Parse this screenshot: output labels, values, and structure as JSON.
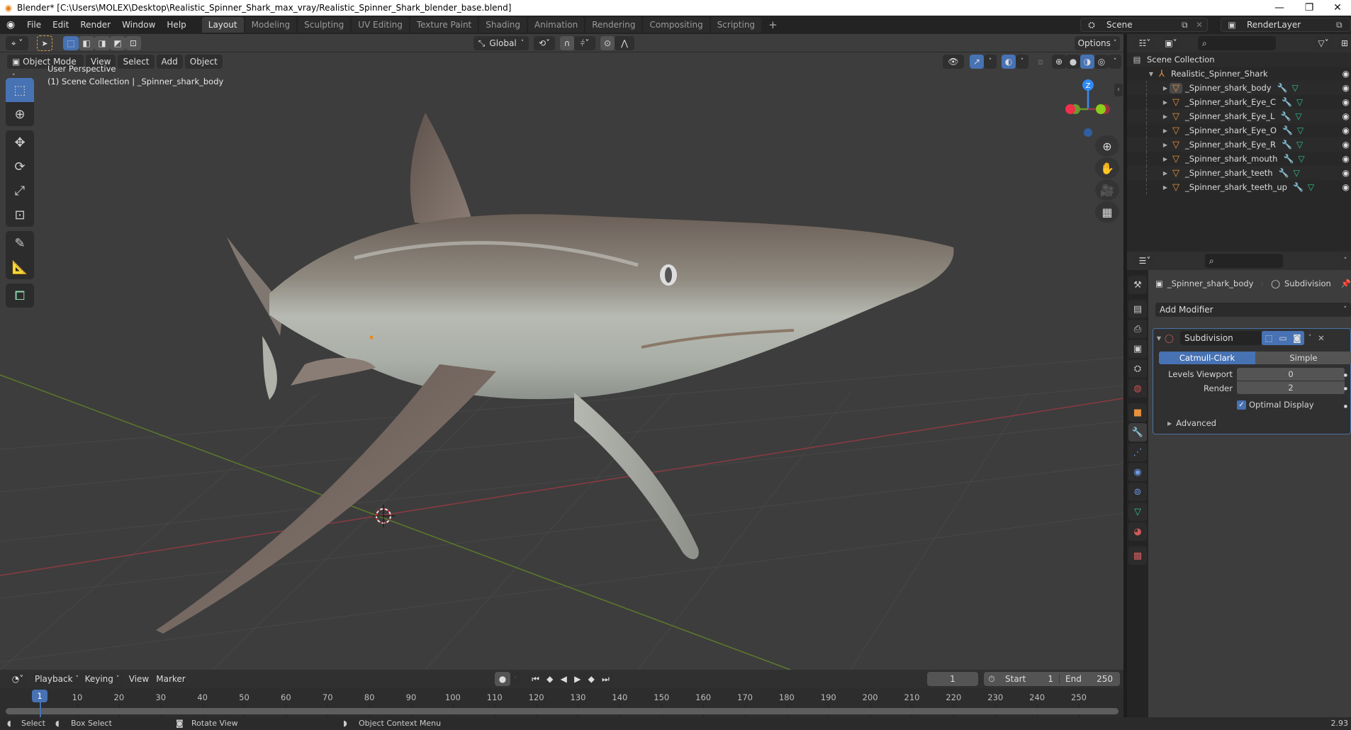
{
  "window": {
    "title": "Blender* [C:\\Users\\MOLEX\\Desktop\\Realistic_Spinner_Shark_max_vray/Realistic_Spinner_Shark_blender_base.blend]",
    "controls": {
      "minimize": "—",
      "restore": "❐",
      "close": "✕"
    }
  },
  "topbar": {
    "menus": [
      "File",
      "Edit",
      "Render",
      "Window",
      "Help"
    ],
    "workspaces": [
      "Layout",
      "Modeling",
      "Sculpting",
      "UV Editing",
      "Texture Paint",
      "Shading",
      "Animation",
      "Rendering",
      "Compositing",
      "Scripting"
    ],
    "active_workspace": "Layout",
    "add_workspace": "+",
    "scene": "Scene",
    "view_layer": "RenderLayer"
  },
  "tool_header": {
    "transform_orientation": "Global",
    "options_label": "Options"
  },
  "viewport": {
    "mode": "Object Mode",
    "menus": [
      "View",
      "Select",
      "Add",
      "Object"
    ],
    "overlay_line1": "User Perspective",
    "overlay_line2": "(1) Scene Collection | _Spinner_shark_body",
    "gizmo": {
      "z": "Z",
      "y": "Y",
      "x": "X"
    }
  },
  "outliner": {
    "root": "Scene Collection",
    "collection": "Realistic_Spinner_Shark",
    "objects": [
      {
        "name": "_Spinner_shark_body",
        "selected": true
      },
      {
        "name": "_Spinner_shark_Eye_C",
        "selected": false
      },
      {
        "name": "_Spinner_shark_Eye_L",
        "selected": false
      },
      {
        "name": "_Spinner_shark_Eye_O",
        "selected": false
      },
      {
        "name": "_Spinner_shark_Eye_R",
        "selected": false
      },
      {
        "name": "_Spinner_shark_mouth",
        "selected": false
      },
      {
        "name": "_Spinner_shark_teeth",
        "selected": false
      },
      {
        "name": "_Spinner_shark_teeth_up",
        "selected": false
      }
    ]
  },
  "properties": {
    "breadcrumb_object": "_Spinner_shark_body",
    "breadcrumb_modifier": "Subdivision",
    "add_modifier": "Add Modifier",
    "modifier": {
      "name": "Subdivision",
      "types": [
        "Catmull-Clark",
        "Simple"
      ],
      "active_type": "Catmull-Clark",
      "levels_viewport_label": "Levels Viewport",
      "levels_viewport": "0",
      "render_label": "Render",
      "render": "2",
      "optimal_display_label": "Optimal Display",
      "optimal_display": true,
      "advanced_label": "Advanced"
    }
  },
  "timeline": {
    "menus": [
      "Playback",
      "Keying",
      "View",
      "Marker"
    ],
    "current_frame": "1",
    "start_label": "Start",
    "start": "1",
    "end_label": "End",
    "end": "250",
    "ticks": [
      "10",
      "20",
      "30",
      "40",
      "50",
      "60",
      "70",
      "80",
      "90",
      "100",
      "110",
      "120",
      "130",
      "140",
      "150",
      "160",
      "170",
      "180",
      "190",
      "200",
      "210",
      "220",
      "230",
      "240",
      "250"
    ],
    "playhead_label": "1"
  },
  "statusbar": {
    "items": [
      "Select",
      "Box Select",
      "Rotate View",
      "Object Context Menu"
    ],
    "version": "2.93"
  }
}
